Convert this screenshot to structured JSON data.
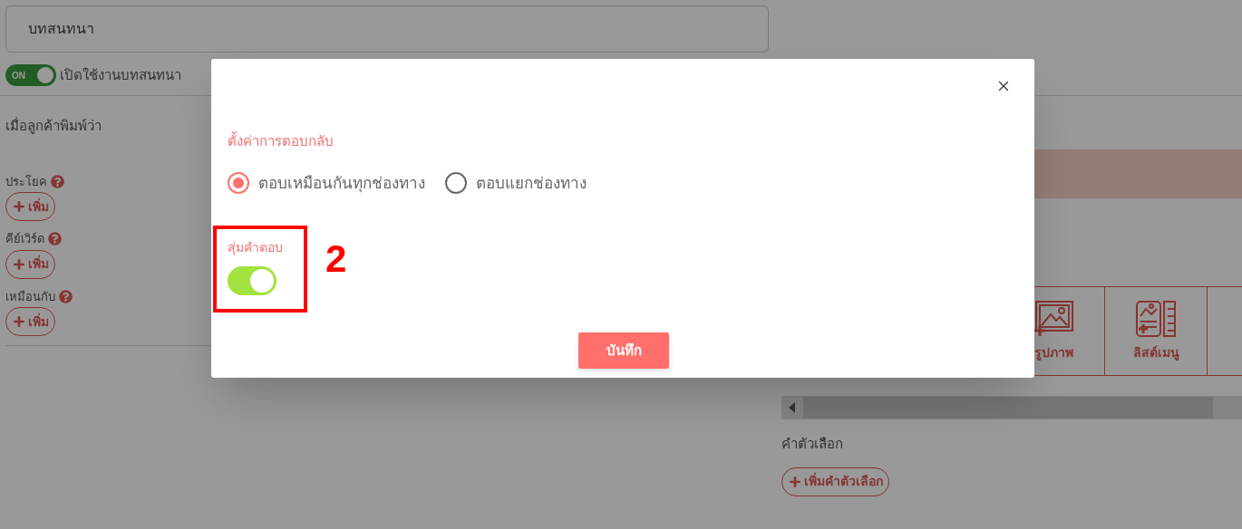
{
  "page": {
    "title_field": {
      "value": "บทสนทนา"
    },
    "enable_toggle": {
      "on": true,
      "label": "ON",
      "text": "เปิดใช้งานบทสนทนา"
    },
    "trigger_heading": "เมื่อลูกค้าพิมพ์ว่า",
    "trigger_groups": [
      {
        "label": "ประโยค",
        "button": "เพิ่ม"
      },
      {
        "label": "คีย์เวิร์ด",
        "button": "เพิ่ม"
      },
      {
        "label": "เหมือนกับ",
        "button": "เพิ่ม"
      }
    ],
    "message_types": [
      {
        "kind": "image",
        "label": "รูปภาพ"
      },
      {
        "kind": "list",
        "label": "ลิสต์เมนู"
      }
    ],
    "choices_heading": "คำตัวเลือก",
    "add_choice_button": "เพิ่มคำตัวเลือก"
  },
  "dialog": {
    "heading": "ตั้งค่าการตอบกลับ",
    "reply_modes": [
      {
        "label": "ตอบเหมือนกันทุกช่องทาง",
        "selected": true
      },
      {
        "label": "ตอบแยกช่องทาง",
        "selected": false
      }
    ],
    "random_answer": {
      "label": "สุ่มคำตอบ",
      "on": true
    },
    "save_button": "บันทึก"
  },
  "annotation": {
    "number": "2"
  }
}
